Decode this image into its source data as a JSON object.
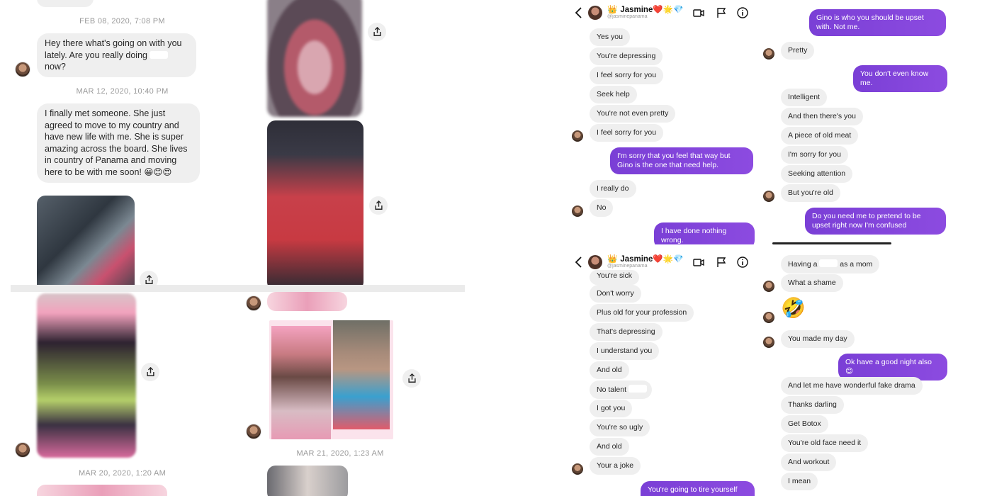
{
  "left": {
    "p1": {
      "timestamp_1": "FEB 08, 2020, 7:08 PM",
      "msg_1": "Hey there what's going on with you lately.  Are you really doing",
      "msg_1_end": "now?",
      "timestamp_2": "MAR 12, 2020, 10:40 PM",
      "msg_2": "I finally met someone. She just agreed to move to my country and have new life with me. She is super amazing across the board. She lives in country of Panama and moving here to be with me soon!",
      "msg_2_emojis": "😀😊😍"
    },
    "p3": {
      "timestamp": "MAR 20, 2020, 1:20 AM"
    },
    "p4": {
      "timestamp": "MAR 21, 2020, 1:23 AM"
    }
  },
  "ig": {
    "contact_name": "Jasmine",
    "contact_badges": "❤️🌟💎",
    "contact_handle": "@jasminepanama",
    "q1": {
      "them": [
        "Yes you",
        "You're depressing",
        "I feel sorry for you",
        "Seek help",
        "You're not even pretty",
        "I feel sorry for you"
      ],
      "me_1": "I'm sorry that you feel that way but Gino is the one that need help.",
      "them_2": [
        "I really do",
        "No"
      ],
      "me_2": "I have done nothing wrong."
    },
    "q2": {
      "me_1": "Gino is who you should be upset with. Not me.",
      "them_1": "Pretty",
      "me_2": "You don't even know me.",
      "them_2": [
        "Intelligent",
        "And then there's you",
        "A piece of old meat",
        "I'm sorry for you",
        "Seeking attention",
        "But you're old"
      ],
      "me_3": "Do you need me to pretend to be upset right now I'm confused"
    },
    "q3": {
      "them": [
        "You're sick",
        "Don't worry",
        "Plus old for your profession",
        "That's depressing",
        "I understand you",
        "And old",
        "No talent",
        "I got you",
        "You're so ugly",
        "And old",
        "Your a joke"
      ],
      "me_1": "You're going to tire yourself out"
    },
    "q4": {
      "them_1": "Having a",
      "them_1_end": "as a mom",
      "them_2": "What a shame",
      "emoji": "🤣",
      "them_3": "You made my day",
      "me_1": "Ok have a good night also 😊",
      "them_4": [
        "And let me have wonderful fake drama",
        "Thanks darling",
        "Get Botox",
        "You're old face need it",
        "And workout",
        "I mean"
      ]
    }
  },
  "colors": {
    "sent_bubble": "#7a3fd6",
    "received_bubble": "#efefef",
    "divider": "#ebebeb"
  },
  "icons": [
    "share-icon",
    "back-chevron-icon",
    "video-camera-icon",
    "flag-icon",
    "info-icon"
  ]
}
